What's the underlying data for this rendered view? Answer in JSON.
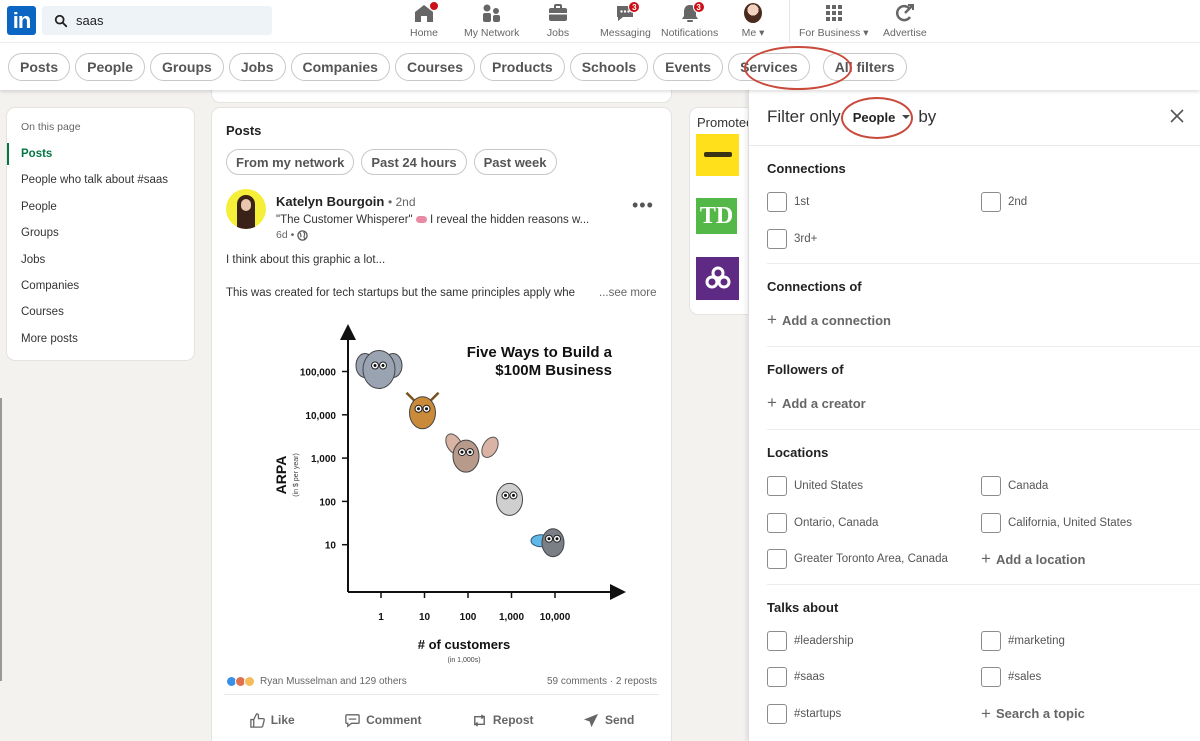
{
  "search": {
    "query": "saas"
  },
  "nav": {
    "items": [
      {
        "label": "Home",
        "icon": "home-icon",
        "badge": ""
      },
      {
        "label": "My Network",
        "icon": "network-icon",
        "badge": ""
      },
      {
        "label": "Jobs",
        "icon": "briefcase-icon",
        "badge": ""
      },
      {
        "label": "Messaging",
        "icon": "messaging-icon",
        "badge": "3"
      },
      {
        "label": "Notifications",
        "icon": "bell-icon",
        "badge": "3"
      },
      {
        "label": "Me",
        "icon": "avatar-icon",
        "badge": ""
      },
      {
        "label": "For Business",
        "icon": "grid-icon",
        "badge": ""
      },
      {
        "label": "Advertise",
        "icon": "advertise-icon",
        "badge": ""
      }
    ]
  },
  "filters": {
    "pills": [
      "Posts",
      "People",
      "Groups",
      "Jobs",
      "Companies",
      "Courses",
      "Products",
      "Schools",
      "Events",
      "Services",
      "All filters"
    ]
  },
  "sidebar": {
    "header": "On this page",
    "items": [
      "Posts",
      "People who talk about #saas",
      "People",
      "Groups",
      "Jobs",
      "Companies",
      "Courses",
      "More posts"
    ],
    "active": "Posts"
  },
  "feed": {
    "title": "Posts",
    "subfilters": [
      "From my network",
      "Past 24 hours",
      "Past week"
    ],
    "post": {
      "author": "Katelyn Bourgoin",
      "degree": "• 2nd",
      "headline_a": "\"The Customer Whisperer\"",
      "headline_b": "I reveal the hidden reasons w...",
      "age": "6d •",
      "text1": "I think about this graphic a lot...",
      "text2": "This was created for tech startups but the same principles apply whe",
      "see_more": "...see more",
      "reactions": "Ryan Musselman and 129 others",
      "stats": "59 comments · 2 reposts",
      "actions": [
        "Like",
        "Comment",
        "Repost",
        "Send"
      ]
    }
  },
  "chart_data": {
    "type": "scatter",
    "title": "Five Ways to Build a $100M Business",
    "xlabel": "# of customers",
    "xlabel_sub": "(in 1,000s)",
    "ylabel": "ARPA",
    "ylabel_sub": "(in $ per year)",
    "x_scale": "log",
    "y_scale": "log",
    "x_ticks": [
      "1",
      "10",
      "100",
      "1,000",
      "10,000"
    ],
    "y_ticks": [
      "10",
      "100",
      "1,000",
      "10,000",
      "100,000"
    ],
    "points": [
      {
        "name": "Elephant",
        "x": 1,
        "y": 100000
      },
      {
        "name": "Deer",
        "x": 10,
        "y": 10000
      },
      {
        "name": "Rabbit",
        "x": 100,
        "y": 1000
      },
      {
        "name": "Mouse",
        "x": 1000,
        "y": 100
      },
      {
        "name": "Fly",
        "x": 10000,
        "y": 10
      }
    ]
  },
  "promo": {
    "title": "Promoted"
  },
  "panel": {
    "prefix": "Filter only",
    "selected": "People",
    "suffix": "by",
    "sections": [
      {
        "title": "Connections",
        "options": [
          "1st",
          "2nd",
          "3rd+"
        ],
        "add": ""
      },
      {
        "title": "Connections of",
        "options": [],
        "add": "Add a connection"
      },
      {
        "title": "Followers of",
        "options": [],
        "add": "Add a creator"
      },
      {
        "title": "Locations",
        "options": [
          "United States",
          "Canada",
          "Ontario, Canada",
          "California, United States",
          "Greater Toronto Area, Canada"
        ],
        "add": "Add a location"
      },
      {
        "title": "Talks about",
        "options": [
          "#leadership",
          "#marketing",
          "#saas",
          "#sales",
          "#startups"
        ],
        "add": "Search a topic"
      }
    ]
  },
  "colors": {
    "brand": "#0a66c2",
    "active": "#057642",
    "badge": "#cc1016",
    "annotation": "#c9493b"
  }
}
